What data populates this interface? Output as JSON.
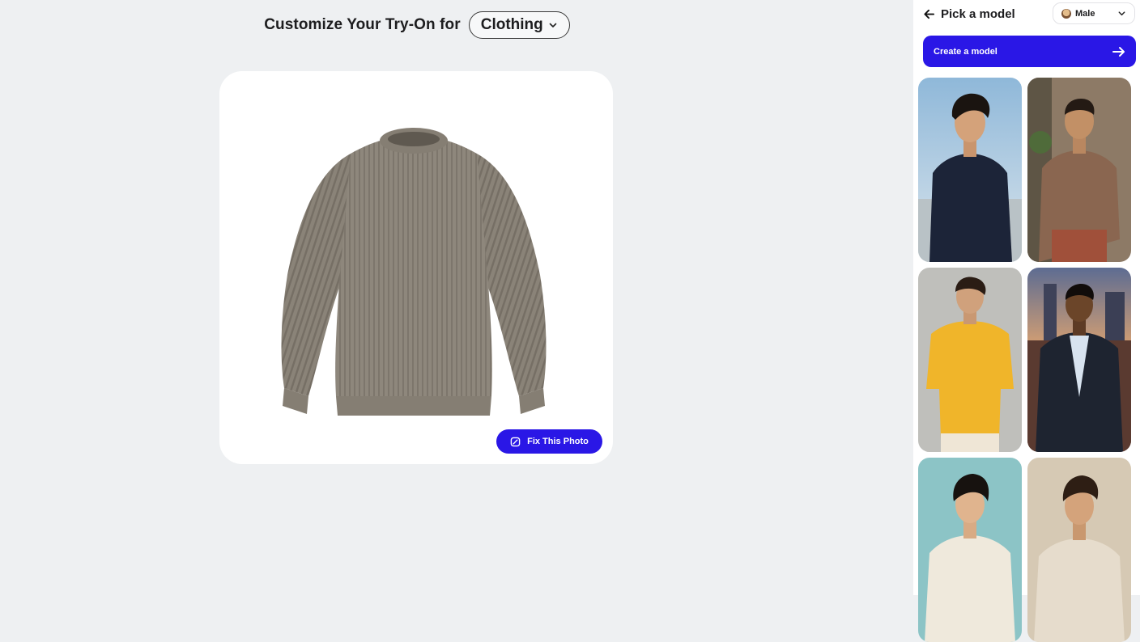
{
  "main": {
    "heading": "Customize Your Try-On for",
    "category_selected": "Clothing",
    "fix_photo_label": "Fix This Photo",
    "product_image_icon": "sweater-image"
  },
  "panel": {
    "back_icon": "arrow-left-icon",
    "title": "Pick a model",
    "gender_selected": "Male",
    "create_model_label": "Create a model",
    "models": [
      {
        "name": "model-navy-sweater",
        "sweater_color": "#1c2438"
      },
      {
        "name": "model-brown-sweater",
        "sweater_color": "#8a6650"
      },
      {
        "name": "model-yellow-tee",
        "sweater_color": "#f0b52a"
      },
      {
        "name": "model-blazer",
        "sweater_color": "#1e2430"
      },
      {
        "name": "model-cream-jacket",
        "sweater_color": "#efe9dc"
      },
      {
        "name": "model-beige-sweater",
        "sweater_color": "#e6dccc"
      }
    ]
  },
  "colors": {
    "accent": "#2a17e6",
    "background": "#eef0f2"
  }
}
